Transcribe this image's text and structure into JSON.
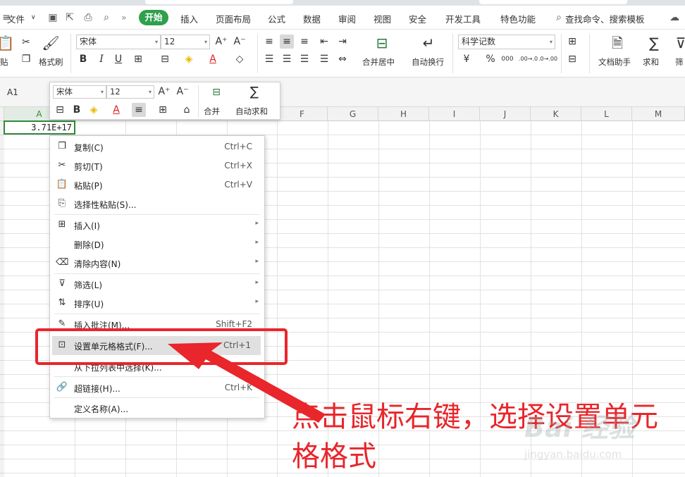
{
  "menubar": {
    "file": "文件",
    "tabs": [
      "开始",
      "插入",
      "页面布局",
      "公式",
      "数据",
      "审阅",
      "视图",
      "安全",
      "开发工具",
      "特色功能"
    ],
    "active_tab": "开始",
    "search": "查找命令、搜索模板",
    "double_chevron": "»",
    "chevron_down": "∨"
  },
  "ribbon": {
    "paste_label": "贴",
    "format_painter": "格式刷",
    "font_name": "宋体",
    "font_size": "12",
    "merge_center": "合并居中",
    "wrap_text": "自动换行",
    "number_format": "科学记数",
    "doc_assistant": "文档助手",
    "sum": "求和",
    "filter_partial": "筛",
    "dropdown": "▾",
    "font_grow": "A⁺",
    "font_shrink": "A⁻",
    "bold": "B",
    "italic": "I",
    "underline": "U",
    "font_color_letter": "A",
    "percent": "%",
    "thousands": "000",
    "inc_decimal": ".00→.0",
    "dec_decimal": ".0→.00",
    "currency": "¥"
  },
  "formula_bar": {
    "name_box": "A1"
  },
  "grid": {
    "columns": [
      "A",
      "F",
      "G",
      "H",
      "I",
      "J",
      "K",
      "L",
      "M"
    ],
    "cell_a1": "3.71E+17"
  },
  "mini_toolbar": {
    "font_name": "宋体",
    "font_size": "12",
    "merge": "合并",
    "autosum": "自动求和",
    "font_grow": "A⁺",
    "font_shrink": "A⁻",
    "bold": "B",
    "font_color_letter": "A",
    "dropdown": "▾",
    "sum_symbol": "∑"
  },
  "context_menu": {
    "items": [
      {
        "label": "复制(C)",
        "shortcut": "Ctrl+C"
      },
      {
        "label": "剪切(T)",
        "shortcut": "Ctrl+X"
      },
      {
        "label": "粘贴(P)",
        "shortcut": "Ctrl+V"
      },
      {
        "label": "选择性粘贴(S)...",
        "shortcut": ""
      },
      {
        "label": "插入(I)",
        "shortcut": ""
      },
      {
        "label": "删除(D)",
        "shortcut": ""
      },
      {
        "label": "清除内容(N)",
        "shortcut": ""
      },
      {
        "label": "筛选(L)",
        "shortcut": ""
      },
      {
        "label": "排序(U)",
        "shortcut": ""
      },
      {
        "label": "插入批注(M)...",
        "shortcut": "Shift+F2"
      },
      {
        "label": "设置单元格格式(F)...",
        "shortcut": "Ctrl+1"
      },
      {
        "label": "从下拉列表中选择(K)...",
        "shortcut": ""
      },
      {
        "label": "超链接(H)...",
        "shortcut": "Ctrl+K"
      },
      {
        "label": "定义名称(A)...",
        "shortcut": ""
      }
    ],
    "submenu_arrow": "▸"
  },
  "annotation": {
    "text": "点击鼠标右键，选择设置单元格格式",
    "color": "#e8262b"
  },
  "watermark": {
    "main": "Bai 经验",
    "sub": "jingyan.baidu.com"
  },
  "colors": {
    "accent": "#2fa04c",
    "selection": "#2f8a3c",
    "annotation": "#e8262b"
  }
}
